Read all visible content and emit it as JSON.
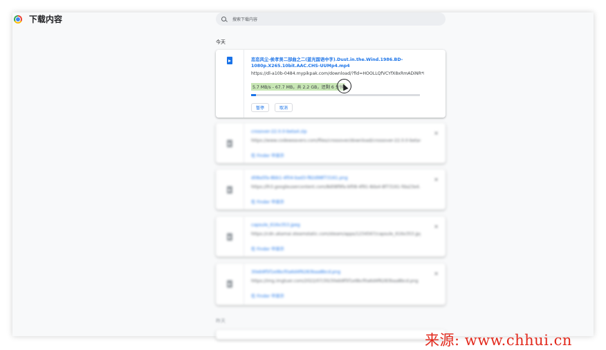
{
  "header": {
    "app_title": "下载内容",
    "logo": "chrome-logo"
  },
  "search": {
    "placeholder": "搜索下载内容",
    "icon": "search-icon"
  },
  "sections": {
    "today": "今天",
    "earlier": "昨天"
  },
  "active_download": {
    "file_name": "恋恋风尘-侯孝贤二部曲之二(蓝光国语中字).Dust.in.the.Wind.1986.BD-1080p.X265.10bit.AAC.CHS-UUMp4.mp4",
    "url": "https://dl-a10b-0484.mypikpak.com/download/?fid=HOOLLQfVCYfX8xRmADiNR*MX...",
    "progress_text": "5.7 MB/s - 67.7 MB，共 2.2 GB，还剩 6 分钟",
    "progress_fraction": 0.03,
    "pause_label": "暂停",
    "cancel_label": "取消",
    "icon": "video-file-icon"
  },
  "other_downloads": [
    {
      "name": "crosover-22.0.0-beta4.zip",
      "url": "https://www.codeweavers.com/files/crossover/download/crossover-22.0.0-beta4.zip",
      "link": "在 Finder 中显示"
    },
    {
      "name": "d08a5fa-8bb1-4f04-bad3-f82d98f73161.png",
      "url": "https://lh3.googleusercontent.com/8d08f9fa-bf08-4f91-8da4-8f73161-fda23e4...",
      "link": "在 Finder 中显示"
    },
    {
      "name": "capsule_616x353.jpeg",
      "url": "https://cdn.akamai.steamstatic.com/steam/apps/1234567/capsule_616x353.jpg?t=1...",
      "link": "在 Finder 中显示"
    },
    {
      "name": "30eb9f5f1e9bcf0a6d4f6283baa8bcd.png",
      "url": "https://img.imgtuer.com/2022/07/30/30eb9f5f1e9bcf0a6d4f6283baa8bcd.png",
      "link": "在 Finder 中显示"
    }
  ],
  "close_glyph": "×",
  "watermark": "来源: www.chhui.cn",
  "colors": {
    "accent": "#1a73e8",
    "progress_highlight": "#c7e6b4",
    "watermark": "#e2291c"
  }
}
